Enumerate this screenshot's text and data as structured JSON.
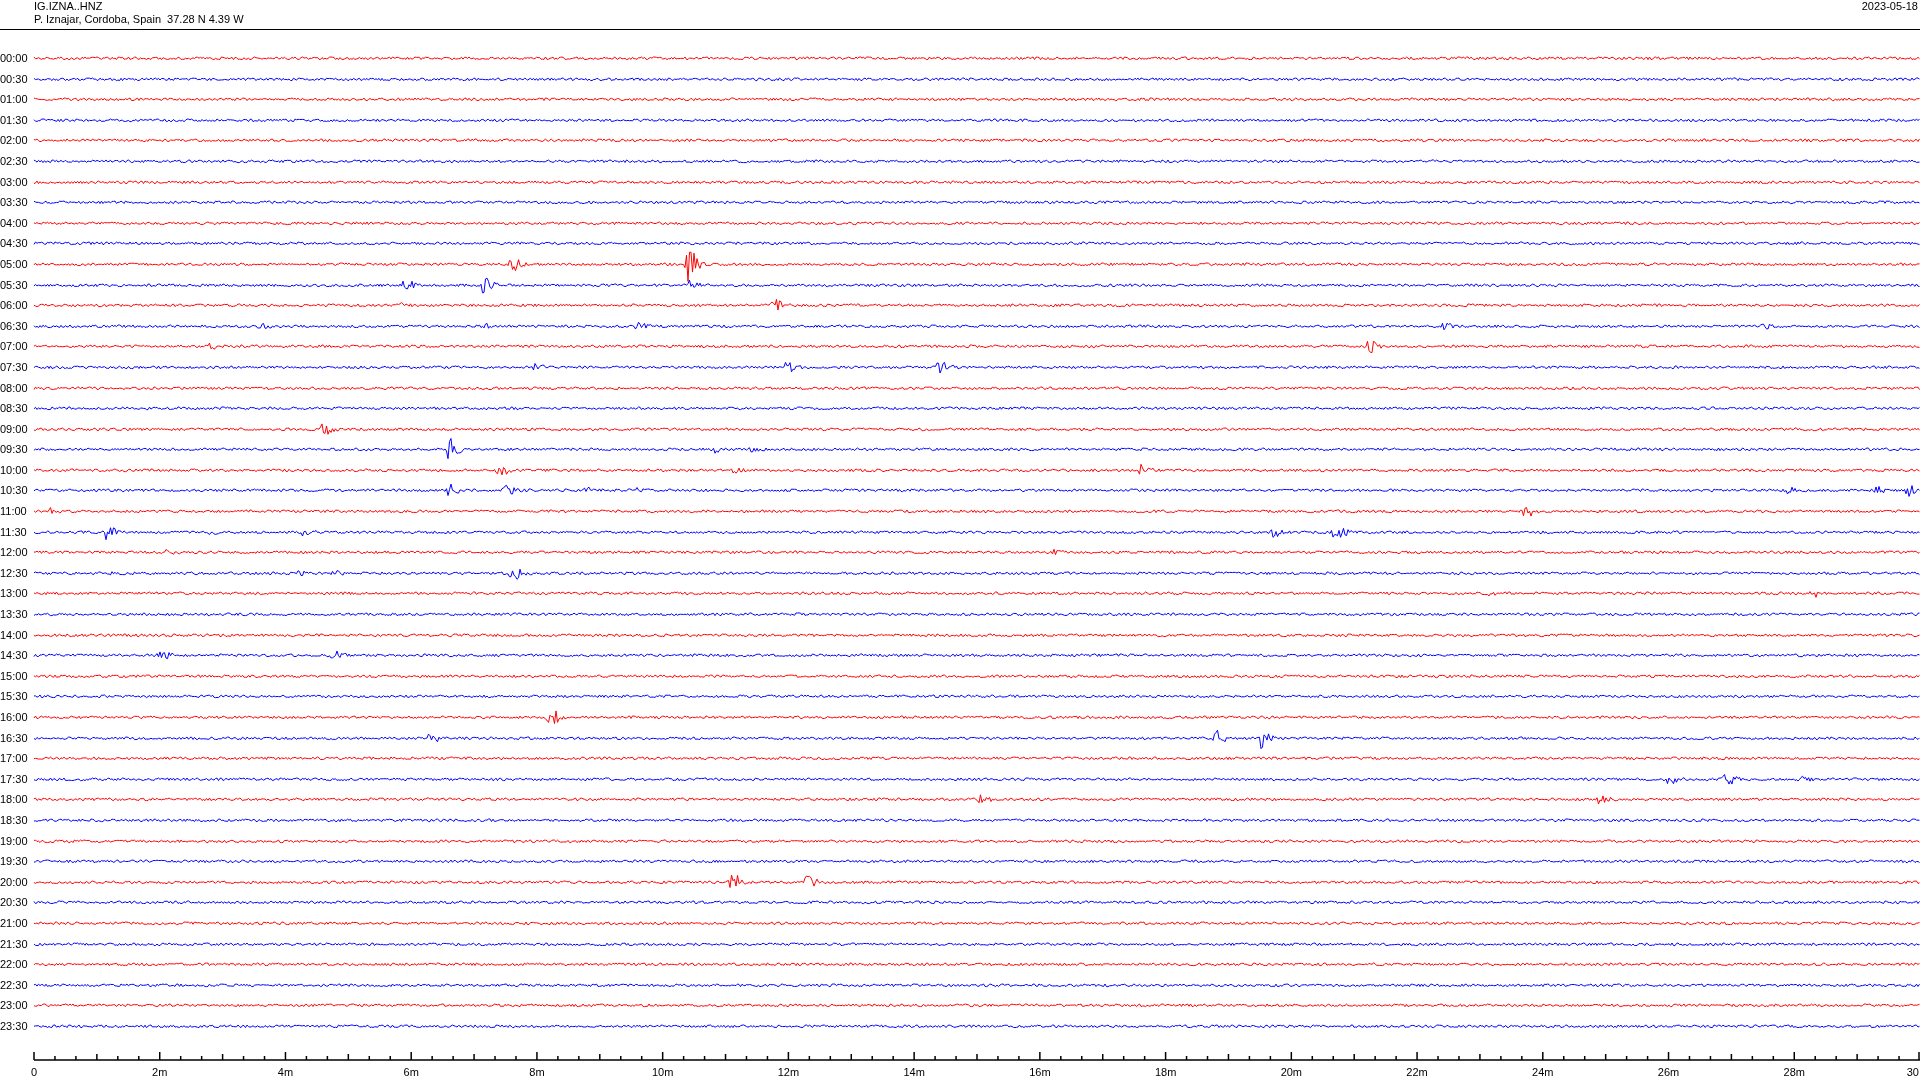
{
  "header": {
    "station": "IG.IZNA..HNZ",
    "location": "P. Iznajar, Cordoba, Spain  37.28 N 4.39 W",
    "date": "2023-05-18"
  },
  "traces": [
    {
      "label": "00:00",
      "color": "#ff0000"
    },
    {
      "label": "00:30",
      "color": "#0000ff"
    },
    {
      "label": "01:00",
      "color": "#ff0000"
    },
    {
      "label": "01:30",
      "color": "#0000ff"
    },
    {
      "label": "02:00",
      "color": "#ff0000"
    },
    {
      "label": "02:30",
      "color": "#0000ff"
    },
    {
      "label": "03:00",
      "color": "#ff0000"
    },
    {
      "label": "03:30",
      "color": "#0000ff"
    },
    {
      "label": "04:00",
      "color": "#ff0000"
    },
    {
      "label": "04:30",
      "color": "#0000ff"
    },
    {
      "label": "05:00",
      "color": "#ff0000"
    },
    {
      "label": "05:30",
      "color": "#0000ff"
    },
    {
      "label": "06:00",
      "color": "#ff0000"
    },
    {
      "label": "06:30",
      "color": "#0000ff"
    },
    {
      "label": "07:00",
      "color": "#ff0000"
    },
    {
      "label": "07:30",
      "color": "#0000ff"
    },
    {
      "label": "08:00",
      "color": "#ff0000"
    },
    {
      "label": "08:30",
      "color": "#0000ff"
    },
    {
      "label": "09:00",
      "color": "#ff0000"
    },
    {
      "label": "09:30",
      "color": "#0000ff"
    },
    {
      "label": "10:00",
      "color": "#ff0000"
    },
    {
      "label": "10:30",
      "color": "#0000ff"
    },
    {
      "label": "11:00",
      "color": "#ff0000"
    },
    {
      "label": "11:30",
      "color": "#0000ff"
    },
    {
      "label": "12:00",
      "color": "#ff0000"
    },
    {
      "label": "12:30",
      "color": "#0000ff"
    },
    {
      "label": "13:00",
      "color": "#ff0000"
    },
    {
      "label": "13:30",
      "color": "#0000ff"
    },
    {
      "label": "14:00",
      "color": "#ff0000"
    },
    {
      "label": "14:30",
      "color": "#0000ff"
    },
    {
      "label": "15:00",
      "color": "#ff0000"
    },
    {
      "label": "15:30",
      "color": "#0000ff"
    },
    {
      "label": "16:00",
      "color": "#ff0000"
    },
    {
      "label": "16:30",
      "color": "#0000ff"
    },
    {
      "label": "17:00",
      "color": "#ff0000"
    },
    {
      "label": "17:30",
      "color": "#0000ff"
    },
    {
      "label": "18:00",
      "color": "#ff0000"
    },
    {
      "label": "18:30",
      "color": "#0000ff"
    },
    {
      "label": "19:00",
      "color": "#ff0000"
    },
    {
      "label": "19:30",
      "color": "#0000ff"
    },
    {
      "label": "20:00",
      "color": "#ff0000"
    },
    {
      "label": "20:30",
      "color": "#0000ff"
    },
    {
      "label": "21:00",
      "color": "#ff0000"
    },
    {
      "label": "21:30",
      "color": "#0000ff"
    },
    {
      "label": "22:00",
      "color": "#ff0000"
    },
    {
      "label": "22:30",
      "color": "#0000ff"
    },
    {
      "label": "23:00",
      "color": "#ff0000"
    },
    {
      "label": "23:30",
      "color": "#0000ff"
    }
  ],
  "axis": {
    "ticks": [
      "0",
      "2m",
      "4m",
      "6m",
      "8m",
      "10m",
      "12m",
      "14m",
      "16m",
      "18m",
      "20m",
      "22m",
      "24m",
      "26m",
      "28m",
      "30"
    ]
  }
}
